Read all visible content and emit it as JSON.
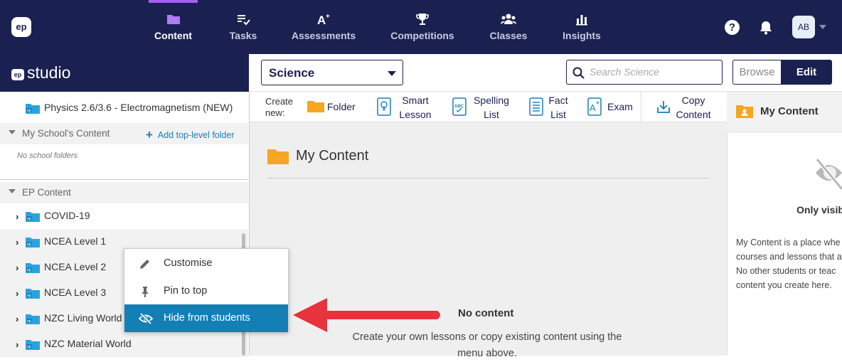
{
  "nav": {
    "logo": "ep",
    "items": [
      {
        "label": "Content",
        "icon": "folder-icon"
      },
      {
        "label": "Tasks",
        "icon": "tasks-icon"
      },
      {
        "label": "Assessments",
        "icon": "assessment-icon"
      },
      {
        "label": "Competitions",
        "icon": "trophy-icon"
      },
      {
        "label": "Classes",
        "icon": "people-icon"
      },
      {
        "label": "Insights",
        "icon": "bar-chart-icon"
      }
    ],
    "help": "?",
    "avatar": "AB",
    "colors": {
      "bg": "#1a2151",
      "active_indicator": "#a75cf0"
    }
  },
  "studio": {
    "badge": "ep",
    "title": "studio"
  },
  "toolbar": {
    "subject": "Science",
    "search_placeholder": "Search Science",
    "browse": "Browse",
    "edit": "Edit"
  },
  "create": {
    "label": "Create new:",
    "items": [
      {
        "label": "Folder",
        "icon": "folder-icon"
      },
      {
        "label": "Smart Lesson",
        "icon": "lightbulb-icon"
      },
      {
        "label": "Spelling List",
        "icon": "spelling-icon"
      },
      {
        "label": "Fact List",
        "icon": "list-icon"
      },
      {
        "label": "Exam",
        "icon": "exam-icon"
      },
      {
        "label": "Copy Content",
        "icon": "download-icon"
      }
    ]
  },
  "sidebar": {
    "top_item": "Physics 2.6/3.6 - Electromagnetism (NEW)",
    "school_section": "My School's Content",
    "add_folder": "Add top-level folder",
    "no_school": "No school folders",
    "ep_section": "EP Content",
    "items": [
      "COVID-19",
      "NCEA Level 1",
      "NCEA Level 2",
      "NCEA Level 3",
      "NZC Living World",
      "NZC Material World"
    ]
  },
  "context_menu": {
    "items": [
      {
        "label": "Customise",
        "icon": "pencil-icon"
      },
      {
        "label": "Pin to top",
        "icon": "pin-icon"
      },
      {
        "label": "Hide from students",
        "icon": "eye-off-icon"
      }
    ],
    "selected_color": "#137fb4"
  },
  "main": {
    "title": "My Content",
    "no_content": "No content",
    "no_content_desc": "Create your own lessons or copy existing content using the menu above."
  },
  "right_panel": {
    "title": "My Content",
    "visibility": "Only visible",
    "desc_lines": [
      "My Content is a place whe",
      "courses and lessons that a",
      "No other students or teac",
      "content you create here."
    ]
  },
  "annotation_arrow_color": "#e8323c"
}
